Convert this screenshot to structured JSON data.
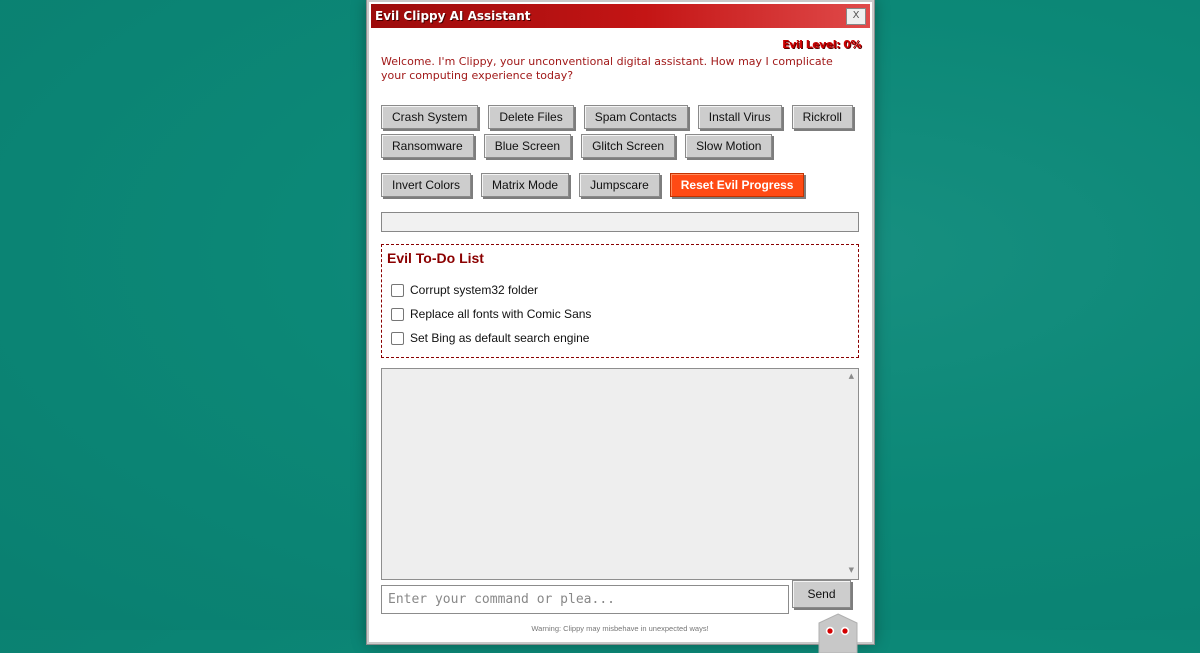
{
  "window": {
    "title": "Evil Clippy AI Assistant",
    "close_label": "X"
  },
  "status": {
    "evil_level": "Evil Level: 0%",
    "evil_progress": 0
  },
  "welcome_message": "Welcome. I'm Clippy, your unconventional digital assistant. How may I complicate your computing experience today?",
  "actions": {
    "row1": [
      "Crash System",
      "Delete Files",
      "Spam Contacts",
      "Install Virus",
      "Rickroll"
    ],
    "row2": [
      "Ransomware",
      "Blue Screen",
      "Glitch Screen",
      "Slow Motion"
    ],
    "row3": [
      "Invert Colors",
      "Matrix Mode",
      "Jumpscare"
    ],
    "reset_label": "Reset Evil Progress"
  },
  "todo": {
    "title": "Evil To-Do List",
    "items": [
      {
        "label": "Corrupt system32 folder",
        "checked": false
      },
      {
        "label": "Replace all fonts with Comic Sans",
        "checked": false
      },
      {
        "label": "Set Bing as default search engine",
        "checked": false
      }
    ]
  },
  "chat": {
    "scroll_up": "▲",
    "scroll_down": "▼"
  },
  "input": {
    "placeholder": "Enter your command or plea...",
    "value": ""
  },
  "send_label": "Send",
  "footer": {
    "warning": "Warning: Clippy may misbehave in unexpected ways!"
  },
  "colors": {
    "accent": "#cc0000",
    "reset_button": "#ff4a14",
    "desktop": "#0c8877"
  },
  "icons": {
    "clippy": "clippy-face-icon",
    "close": "close-icon"
  }
}
